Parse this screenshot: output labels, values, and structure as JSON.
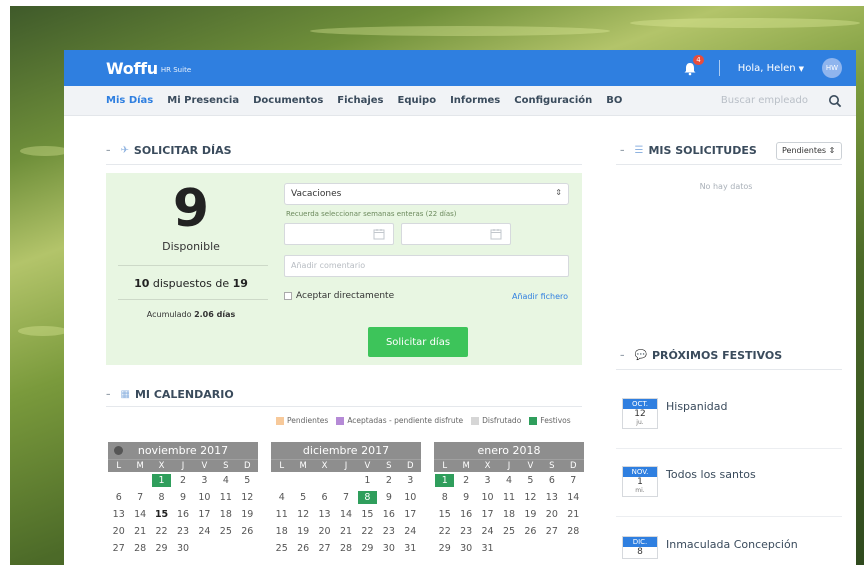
{
  "header": {
    "logo": "Woffu",
    "logo_sub": "HR Suite",
    "notifications": "4",
    "greeting": "Hola, Helen",
    "avatar_initials": "HW"
  },
  "nav": {
    "items": [
      "Mis Días",
      "Mi Presencia",
      "Documentos",
      "Fichajes",
      "Equipo",
      "Informes",
      "Configuración",
      "BO"
    ],
    "active": "Mis Días",
    "search_placeholder": "Buscar empleado"
  },
  "solicitar": {
    "title": "SOLICITAR DÍAS",
    "available_days": "9",
    "available_label": "Disponible",
    "used": "10",
    "used_mid": " dispuestos de ",
    "total": "19",
    "accumulated_label": "Acumulado ",
    "accumulated_value": "2.06 días",
    "type_value": "Vacaciones",
    "hint": "Recuerda seleccionar semanas enteras (22 días)",
    "comment_placeholder": "Añadir comentario",
    "accept_label": "Aceptar directamente",
    "add_file": "Añadir fichero",
    "submit": "Solicitar días"
  },
  "calendar": {
    "title": "MI CALENDARIO",
    "legend": [
      {
        "label": "Pendientes",
        "color": "#f7c99a"
      },
      {
        "label": "Aceptadas - pendiente disfrute",
        "color": "#b58ad6"
      },
      {
        "label": "Disfrutado",
        "color": "#d6d6d6"
      },
      {
        "label": "Festivos",
        "color": "#2f9e5c"
      }
    ],
    "weekdays": [
      "L",
      "M",
      "X",
      "J",
      "V",
      "S",
      "D"
    ],
    "months": [
      {
        "name": "noviembre 2017",
        "offset": 2,
        "days": 30,
        "festivos": [
          1
        ],
        "today": 15
      },
      {
        "name": "diciembre 2017",
        "offset": 4,
        "days": 31,
        "festivos": [
          8
        ],
        "today": null
      },
      {
        "name": "enero 2018",
        "offset": 0,
        "days": 31,
        "festivos": [
          1
        ],
        "today": null
      }
    ]
  },
  "solicitudes": {
    "title": "MIS SOLICITUDES",
    "filter": "Pendientes",
    "empty": "No hay datos"
  },
  "festivos": {
    "title": "PRÓXIMOS FESTIVOS",
    "items": [
      {
        "month": "OCT.",
        "day": "12",
        "weekday": "ju.",
        "name": "Hispanidad"
      },
      {
        "month": "NOV.",
        "day": "1",
        "weekday": "mi.",
        "name": "Todos los santos"
      },
      {
        "month": "DIC.",
        "day": "8",
        "weekday": "",
        "name": "Inmaculada Concepción"
      }
    ]
  }
}
